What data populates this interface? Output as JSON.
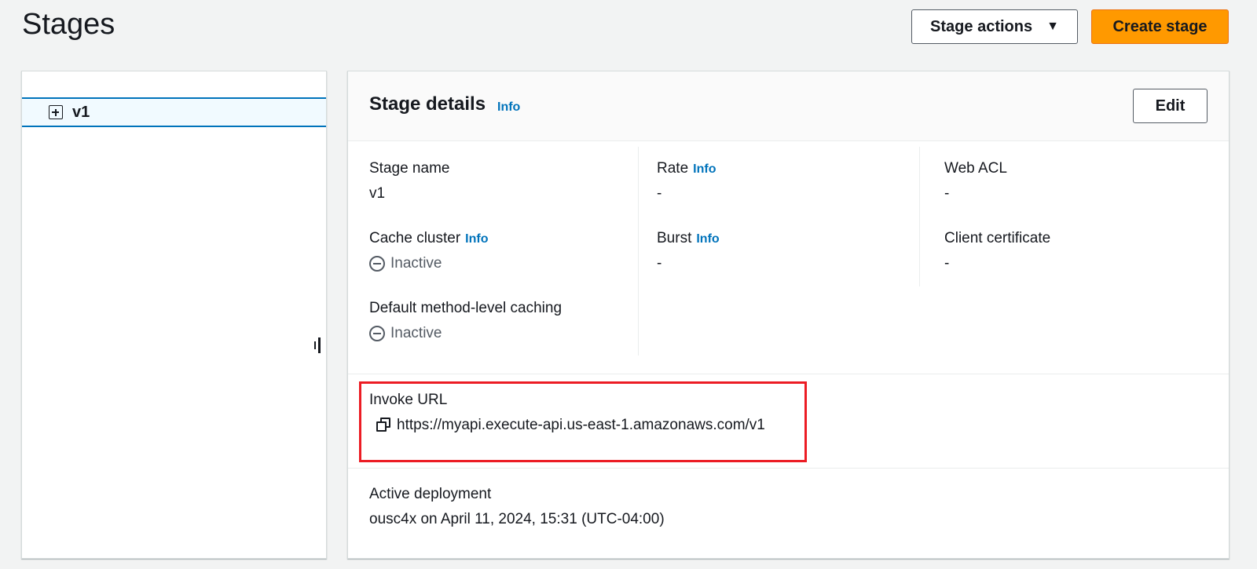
{
  "page": {
    "title": "Stages"
  },
  "header": {
    "stage_actions_label": "Stage actions",
    "create_stage_label": "Create stage"
  },
  "tree": {
    "items": [
      {
        "label": "v1"
      }
    ]
  },
  "details": {
    "title": "Stage details",
    "info_label": "Info",
    "edit_label": "Edit",
    "stage_name": {
      "label": "Stage name",
      "value": "v1"
    },
    "cache_cluster": {
      "label": "Cache cluster",
      "info": "Info",
      "value": "Inactive"
    },
    "method_caching": {
      "label": "Default method-level caching",
      "value": "Inactive"
    },
    "rate": {
      "label": "Rate",
      "info": "Info",
      "value": "-"
    },
    "burst": {
      "label": "Burst",
      "info": "Info",
      "value": "-"
    },
    "web_acl": {
      "label": "Web ACL",
      "value": "-"
    },
    "client_certificate": {
      "label": "Client certificate",
      "value": "-"
    },
    "invoke_url": {
      "label": "Invoke URL",
      "value": "https://myapi.execute-api.us-east-1.amazonaws.com/v1"
    },
    "active_deployment": {
      "label": "Active deployment",
      "value": "ousc4x on April 11, 2024, 15:31 (UTC-04:00)"
    }
  },
  "colors": {
    "accent": "#0073bb",
    "primary_button": "#ff9900",
    "highlight": "#ec1c24"
  }
}
